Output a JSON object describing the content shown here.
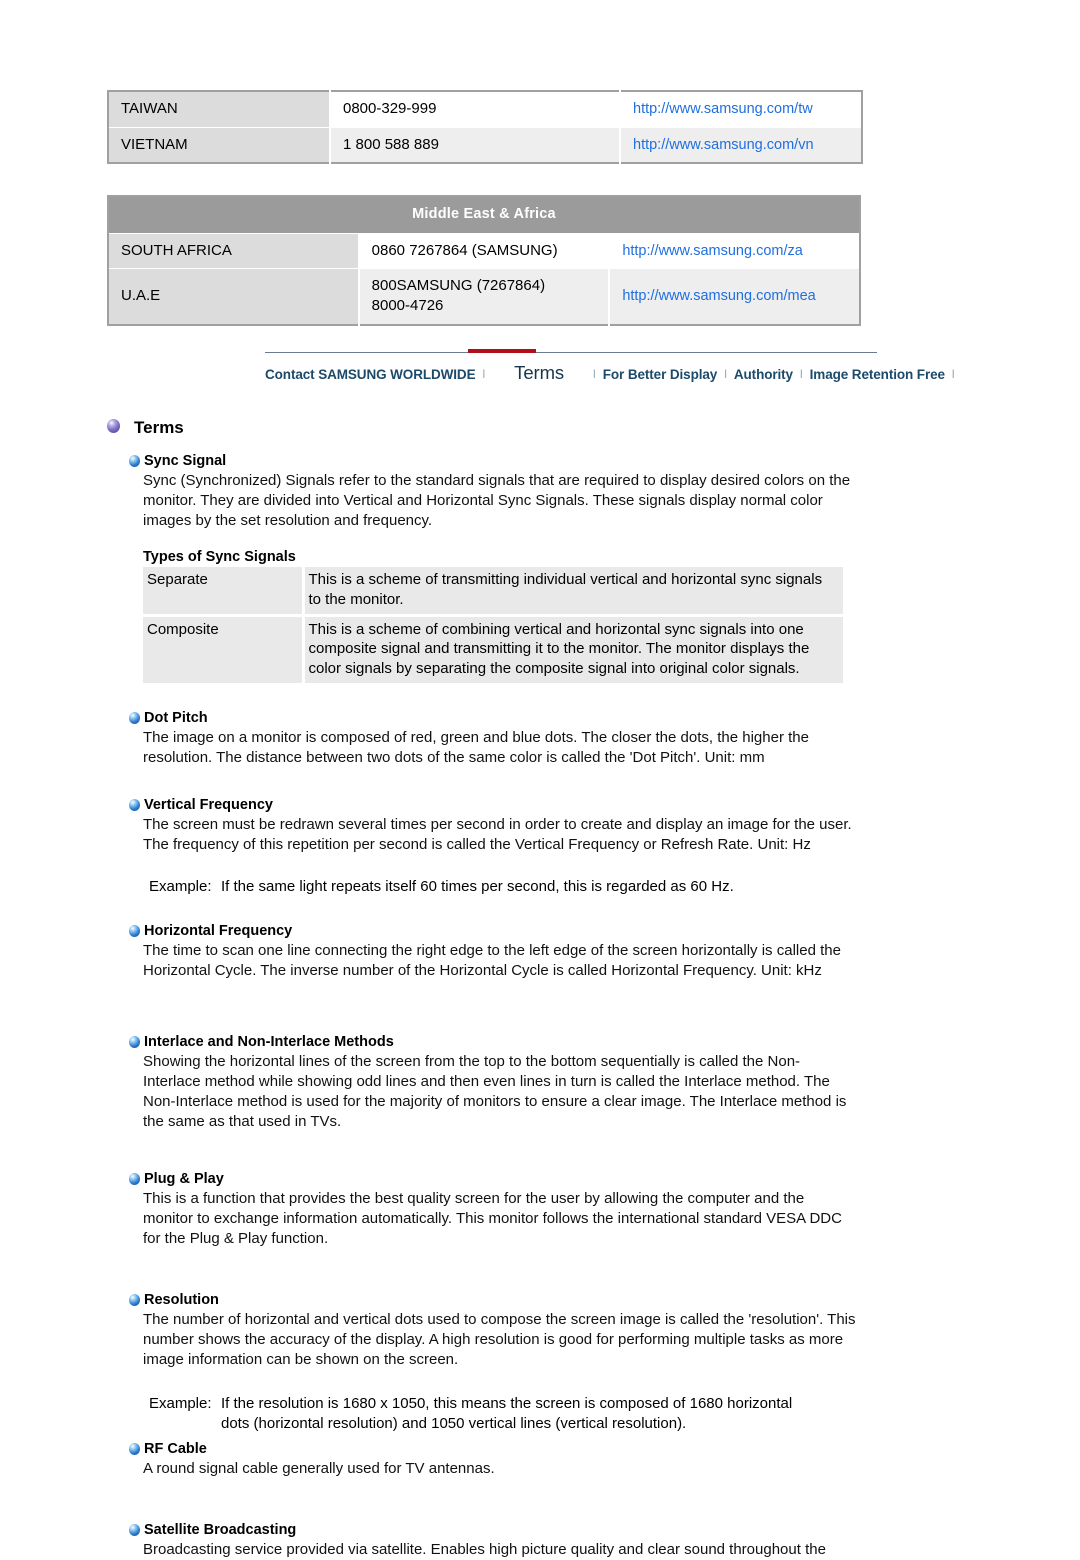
{
  "contact": {
    "asia_rows": [
      {
        "country": "TAIWAN",
        "phone": "0800-329-999",
        "web": "http://www.samsung.com/tw"
      },
      {
        "country": "VIETNAM",
        "phone": "1 800 588 889",
        "web": "http://www.samsung.com/vn"
      }
    ],
    "mea_header": "Middle East & Africa",
    "mea_rows": [
      {
        "country": "SOUTH AFRICA",
        "phone": "0860 7267864 (SAMSUNG)",
        "phone2": "",
        "web": "http://www.samsung.com/za"
      },
      {
        "country": "U.A.E",
        "phone": "800SAMSUNG (7267864)",
        "phone2": "8000-4726",
        "web": "http://www.samsung.com/mea"
      }
    ]
  },
  "nav": {
    "items": [
      {
        "label": "Contact SAMSUNG WORLDWIDE",
        "active": false
      },
      {
        "label": "Terms",
        "active": true
      },
      {
        "label": "For Better Display",
        "active": false
      },
      {
        "label": "Authority",
        "active": false
      },
      {
        "label": "Image Retention Free",
        "active": false
      }
    ],
    "separator": "l",
    "active_color": "#b01118"
  },
  "page": {
    "title": "Terms"
  },
  "sections": {
    "sync_signal": {
      "title": "Sync Signal",
      "body": "Sync (Synchronized) Signals refer to the standard signals that are required to display desired colors on the monitor. They are divided into Vertical and Horizontal Sync Signals. These signals display normal color images by the set resolution and frequency.",
      "sub_title": "Types of Sync Signals",
      "table": [
        {
          "name": "Separate",
          "desc": "This is a scheme of transmitting individual vertical and horizontal sync signals to the monitor."
        },
        {
          "name": "Composite",
          "desc": "This is a scheme of combining vertical and horizontal sync signals into one composite signal and transmitting it to the monitor. The monitor displays the color signals by separating the composite signal into original color signals."
        }
      ]
    },
    "dot_pitch": {
      "title": "Dot Pitch",
      "body": "The image on a monitor is composed of red, green and blue dots. The closer the dots, the higher the resolution. The distance between two dots of the same color is called the 'Dot Pitch'. Unit: mm"
    },
    "vertical_frequency": {
      "title": "Vertical Frequency",
      "body": "The screen must be redrawn several times per second in order to create and display an image for the user. The frequency of this repetition per second is called the Vertical Frequency or Refresh Rate. Unit: Hz",
      "example_label": "Example:",
      "example_text": "If the same light repeats itself 60 times per second, this is regarded as 60 Hz."
    },
    "horizontal_frequency": {
      "title": "Horizontal Frequency",
      "body": "The time to scan one line connecting the right edge to the left edge of the screen horizontally is called the Horizontal Cycle. The inverse number of the Horizontal Cycle is called Horizontal Frequency. Unit: kHz"
    },
    "interlace": {
      "title": "Interlace and Non-Interlace Methods",
      "body": "Showing the horizontal lines of the screen from the top to the bottom sequentially is called the Non-Interlace method while showing odd lines and then even lines in turn is called the Interlace method. The Non-Interlace method is used for the majority of monitors to ensure a clear image. The Interlace method is the same as that used in TVs."
    },
    "plug_and_play": {
      "title": "Plug & Play",
      "body": "This is a function that provides the best quality screen for the user by allowing the computer and the monitor to exchange information automatically. This monitor follows the international standard VESA DDC for the Plug & Play function."
    },
    "resolution": {
      "title": "Resolution",
      "body": "The number of horizontal and vertical dots used to compose the screen image is called the 'resolution'. This number shows the accuracy of the display. A high resolution is good for performing multiple tasks as more image information can be shown on the screen.",
      "example_label": "Example:",
      "example_text": "If the resolution is 1680 x 1050, this means the screen is composed of 1680 horizontal dots (horizontal resolution) and 1050 vertical lines (vertical resolution)."
    },
    "rf_cable": {
      "title": "RF Cable",
      "body": "A round signal cable generally used for TV antennas."
    },
    "satellite": {
      "title": "Satellite Broadcasting",
      "body": "Broadcasting service provided via satellite. Enables high picture quality and clear sound throughout the"
    }
  }
}
